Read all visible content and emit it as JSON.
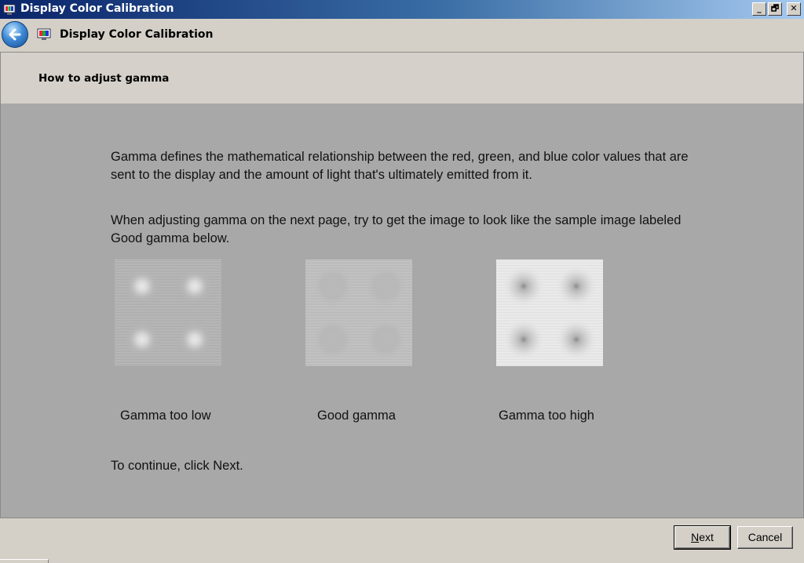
{
  "window": {
    "title": "Display Color Calibration",
    "caption_min": "_",
    "caption_max": "🗗",
    "caption_close": "✕"
  },
  "nav": {
    "title": "Display Color Calibration",
    "back_icon": "back-arrow-icon",
    "app_icon": "color-calibration-icon"
  },
  "header": {
    "heading": "How to adjust gamma"
  },
  "main": {
    "paragraph1": "Gamma defines the mathematical relationship between the red, green, and blue color values that are sent to the display and the amount of light that's ultimately emitted from it.",
    "paragraph2": "When adjusting gamma on the next page, try to get the image to look like the sample image labeled Good gamma below.",
    "samples": [
      {
        "label": "Gamma too low"
      },
      {
        "label": "Good gamma"
      },
      {
        "label": "Gamma too high"
      }
    ],
    "continue_text": "To continue, click Next."
  },
  "footer": {
    "next_accel": "N",
    "next_rest": "ext",
    "cancel_label": "Cancel"
  },
  "colors": {
    "content_bg": "#a8a8a8",
    "chrome_bg": "#d4d0c8",
    "titlebar_start": "#0a246a",
    "titlebar_end": "#a6caf0"
  }
}
